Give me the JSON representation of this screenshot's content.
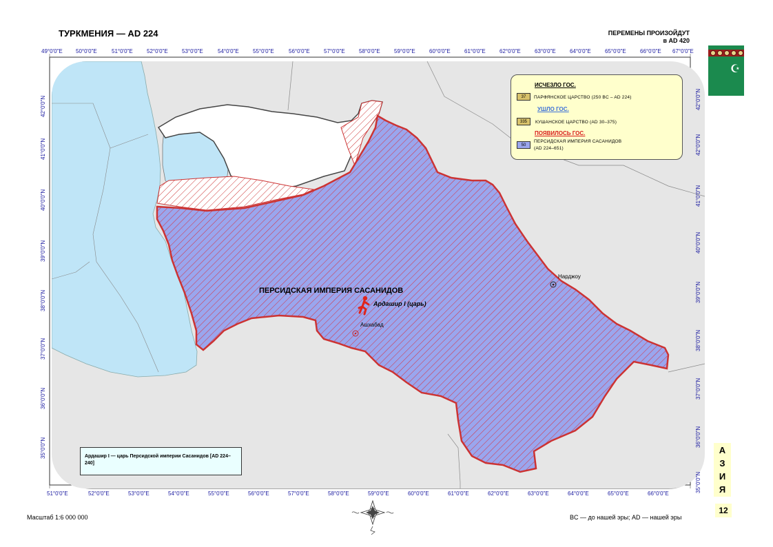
{
  "header": {
    "title": "ТУРКМЕНИЯ — AD 224",
    "changes_line1": "ПЕРЕМЕНЫ ПРОИЗОЙДУТ",
    "changes_line2": "в AD 420"
  },
  "longitude_top": [
    "49°0'0\"E",
    "50°0'0\"E",
    "51°0'0\"E",
    "52°0'0\"E",
    "53°0'0\"E",
    "54°0'0\"E",
    "55°0'0\"E",
    "56°0'0\"E",
    "57°0'0\"E",
    "58°0'0\"E",
    "59°0'0\"E",
    "60°0'0\"E",
    "61°0'0\"E",
    "62°0'0\"E",
    "63°0'0\"E",
    "64°0'0\"E",
    "65°0'0\"E",
    "66°0'0\"E",
    "67°0'0\"E"
  ],
  "longitude_bottom": [
    "51°0'0\"E",
    "52°0'0\"E",
    "53°0'0\"E",
    "54°0'0\"E",
    "55°0'0\"E",
    "56°0'0\"E",
    "57°0'0\"E",
    "58°0'0\"E",
    "59°0'0\"E",
    "60°0'0\"E",
    "61°0'0\"E",
    "62°0'0\"E",
    "63°0'0\"E",
    "64°0'0\"E",
    "65°0'0\"E",
    "66°0'0\"E"
  ],
  "latitude_left": [
    "42°0'0\"N",
    "41°0'0\"N",
    "40°0'0\"N",
    "39°0'0\"N",
    "38°0'0\"N",
    "37°0'0\"N",
    "36°0'0\"N",
    "35°0'0\"N"
  ],
  "latitude_right": [
    "42°0'0\"N",
    "42°0'0\"N",
    "41°0'0\"N",
    "40°0'0\"N",
    "39°0'0\"N",
    "38°0'0\"N",
    "37°0'0\"N",
    "36°0'0\"N",
    "35°0'0\"N"
  ],
  "legend": {
    "disappeared_heading": "ИСЧЕЗЛО ГОС.",
    "disappeared_code": "37",
    "disappeared_name": "ПАРФЯНСКОЕ ЦАРСТВО (250 BC – AD 224)",
    "left_heading": "УШЛО ГОС.",
    "left_code": "335",
    "left_name": "КУШАНСКОЕ ЦАРСТВО (AD 30–375)",
    "appeared_heading": "ПОЯВИЛОСЬ ГОС.",
    "appeared_code": "50",
    "appeared_name_1": "ПЕРСИДСКАЯ ИМПЕРИЯ САСАНИДОВ",
    "appeared_name_2": "(AD 224–651)"
  },
  "map": {
    "empire_label": "ПЕРСИДСКАЯ ИМПЕРИЯ САСАНИДОВ",
    "ruler_label": "Ардашир I (царь)",
    "city_ashgabat": "Ашхабад",
    "city_chardzhou": "Нарджоу"
  },
  "note": "Ардашир I — царь Персидской империи Сасанидов [AD 224–240]",
  "side_tab": {
    "letters": [
      "А",
      "З",
      "И",
      "Я"
    ],
    "page": "12"
  },
  "footer": {
    "scale": "Масштаб 1:6 000 000",
    "era": "BC — до нашей эры; AD — нашей эры"
  },
  "colors": {
    "sea": "#bfe5f7",
    "land": "#e6e6e6",
    "empire_fill": "#9aa6ee",
    "empire_hatch": "#d2384a",
    "border_red": "#cc2222",
    "legend_bg": "#ffffcc",
    "grid_text": "#1a1aa0"
  }
}
